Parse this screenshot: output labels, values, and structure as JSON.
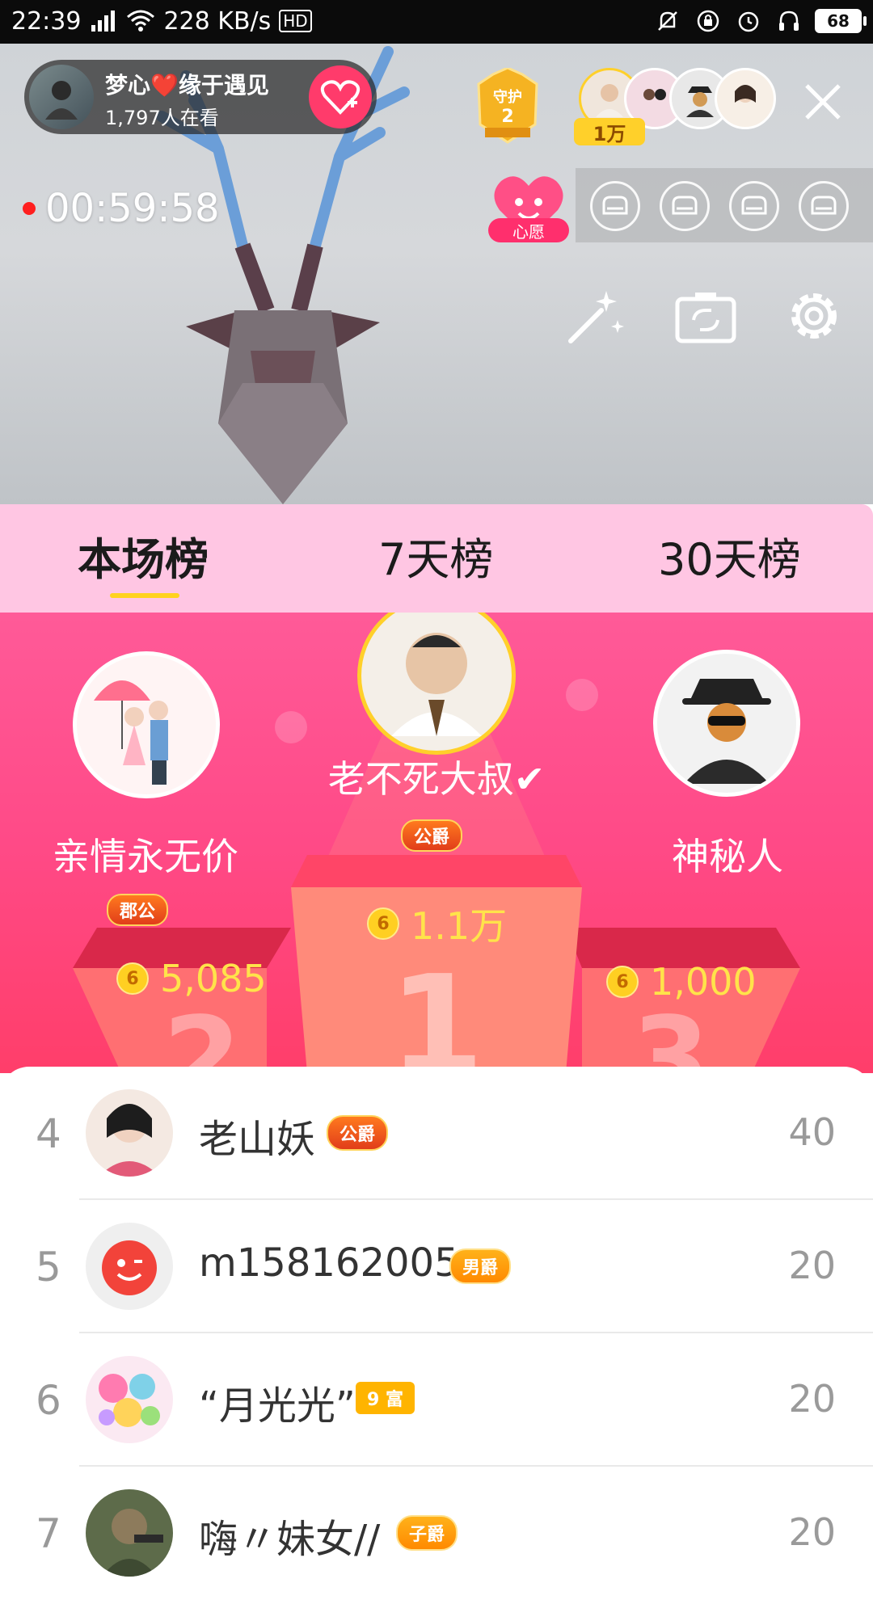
{
  "status_bar": {
    "time": "22:39",
    "network": "4G",
    "speed": "228 KB/s",
    "hd": "HD",
    "battery": "68"
  },
  "room": {
    "streamer_name": "梦心❤️缘于遇见",
    "viewers": "1,797人在看",
    "guard_label": "守护",
    "guard_count": "2",
    "top_fan_count": "1万",
    "timer": "00:59:58",
    "wish_label": "心愿"
  },
  "tabs": [
    "本场榜",
    "7天榜",
    "30天榜"
  ],
  "podium": {
    "first": {
      "name": "老不死大叔✔",
      "noble": "公爵",
      "coins": "1.1万"
    },
    "second": {
      "name": "亲情永无价",
      "noble": "郡公",
      "coins": "5,085"
    },
    "third": {
      "name": "神秘人",
      "noble": "",
      "coins": "1,000"
    },
    "coin_symbol": "6"
  },
  "list": [
    {
      "rank": "4",
      "name": "老山妖",
      "tag": "公爵",
      "score": "40"
    },
    {
      "rank": "5",
      "name": "m158162005",
      "tag": "男爵",
      "score": "20"
    },
    {
      "rank": "6",
      "name": "“月光光”",
      "tag": "9 富",
      "score": "20"
    },
    {
      "rank": "7",
      "name": "嗨〃妹女//",
      "tag": "子爵",
      "score": "20"
    }
  ],
  "colors": {
    "accent_pink": "#ff4a87",
    "tab_bg": "#ffc6e3",
    "coin_yellow": "#ffe34a",
    "follow_red": "#ff3b6b"
  }
}
